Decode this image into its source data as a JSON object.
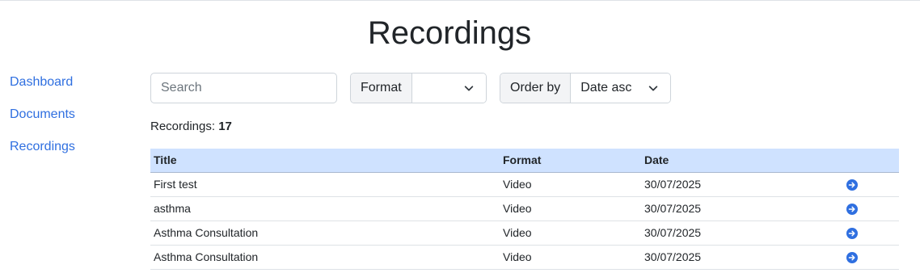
{
  "page": {
    "title": "Recordings"
  },
  "sidebar": {
    "items": [
      {
        "label": "Dashboard"
      },
      {
        "label": "Documents"
      },
      {
        "label": "Recordings"
      }
    ]
  },
  "filters": {
    "search_placeholder": "Search",
    "search_value": "",
    "format_label": "Format",
    "format_value": "",
    "order_label": "Order by",
    "order_value": "Date asc"
  },
  "summary": {
    "label": "Recordings:",
    "count": "17"
  },
  "table": {
    "headers": {
      "title": "Title",
      "format": "Format",
      "date": "Date",
      "action": ""
    },
    "rows": [
      {
        "title": "First test",
        "format": "Video",
        "date": "30/07/2025"
      },
      {
        "title": "asthma",
        "format": "Video",
        "date": "30/07/2025"
      },
      {
        "title": "Asthma Consultation",
        "format": "Video",
        "date": "30/07/2025"
      },
      {
        "title": "Asthma Consultation",
        "format": "Video",
        "date": "30/07/2025"
      }
    ]
  },
  "colors": {
    "link": "#2f6fe0",
    "table_header_bg": "#cfe2ff",
    "action_icon": "#2f6fe0"
  },
  "icons": {
    "select_chevron": "chevron-down-icon",
    "row_action": "arrow-right-circle-icon"
  }
}
